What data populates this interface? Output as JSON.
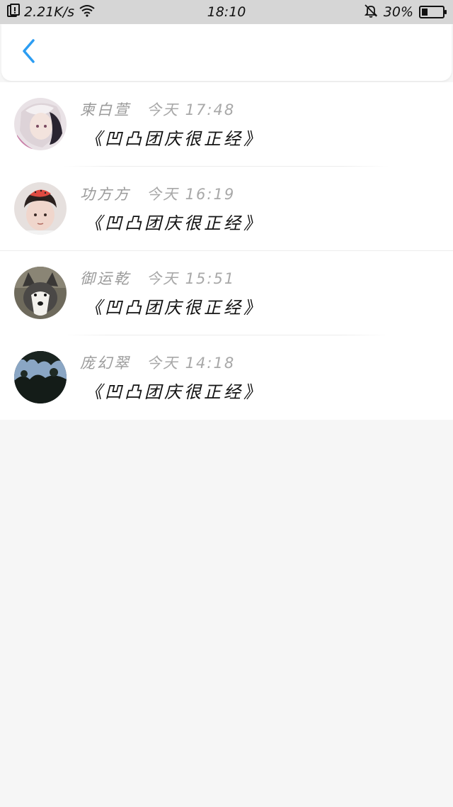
{
  "status_bar": {
    "speed": "2.21K/s",
    "time": "18:10",
    "battery": "30%",
    "battery_level": 0.3
  },
  "nav": {
    "back_icon": "chevron-left-icon",
    "accent_color": "#2c9df2"
  },
  "comments": [
    {
      "name": "柬白萱",
      "time": "今天 17:48",
      "message": "《凹凸团庆很正经》"
    },
    {
      "name": "功方方",
      "time": "今天 16:19",
      "message": "《凹凸团庆很正经》"
    },
    {
      "name": "御运乾",
      "time": "今天 15:51",
      "message": "《凹凸团庆很正经》"
    },
    {
      "name": "庞幻翠",
      "time": "今天 14:18",
      "message": "《凹凸团庆很正经》"
    }
  ]
}
